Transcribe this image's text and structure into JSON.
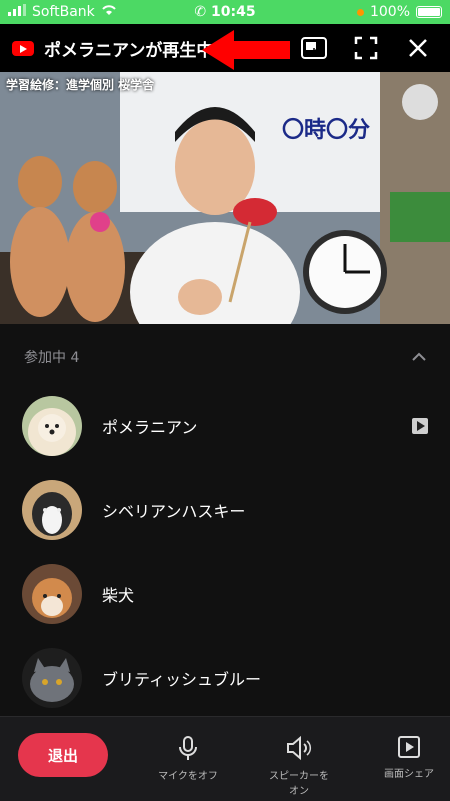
{
  "status_bar": {
    "carrier": "SoftBank",
    "time": "10:45",
    "battery": "100%"
  },
  "header": {
    "title": "ポメラニアンが再生中"
  },
  "video": {
    "watermark": "学習絵修：進学個別 桜学舎",
    "board_text": "〇時〇分"
  },
  "participants": {
    "heading": "参加中 4",
    "items": [
      {
        "name": "ポメラニアン",
        "playing": true
      },
      {
        "name": "シベリアンハスキー"
      },
      {
        "name": "柴犬"
      },
      {
        "name": "ブリティッシュブルー"
      }
    ]
  },
  "bottom_bar": {
    "leave_label": "退出",
    "mic_label": "マイクをオフ",
    "speaker_label": "スピーカーを\nオン",
    "share_label": "画面シェア"
  },
  "colors": {
    "status_green": "#4cd964",
    "leave_red": "#e5364d",
    "youtube_red": "#ff0000",
    "arrow_red": "#ff0000"
  }
}
